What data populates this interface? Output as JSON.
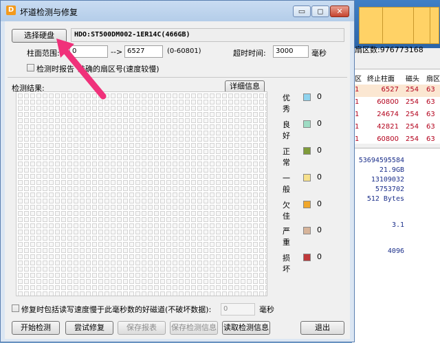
{
  "window": {
    "title": "坏道检测与修复",
    "min_glyph": "▭",
    "max_glyph": "◻",
    "close_glyph": "✕"
  },
  "disk": {
    "select_button": "选择硬盘",
    "info": "HDO:ST500DM002-1ER14C(466GB)"
  },
  "range": {
    "label": "柱面范围:",
    "start": "0",
    "arrow": "-->",
    "end": "6527",
    "hint": "(0-60801)"
  },
  "timeout": {
    "label": "超时时间:",
    "value": "3000",
    "unit": "毫秒"
  },
  "report_option": {
    "label_a": "检测时报告",
    "label_b": "准确的扇区号(速度较慢)"
  },
  "results": {
    "label": "检测结果:",
    "detail_button": "详细信息"
  },
  "legend": [
    {
      "name": "优秀",
      "color": "#8fd3ee",
      "count": "0"
    },
    {
      "name": "良好",
      "color": "#9edcc4",
      "count": "0"
    },
    {
      "name": "正常",
      "color": "#7f9b3a",
      "count": "0"
    },
    {
      "name": "一般",
      "color": "#f6e08c",
      "count": "0"
    },
    {
      "name": "欠佳",
      "color": "#f0a72b",
      "count": "0"
    },
    {
      "name": "严重",
      "color": "#d7b49a",
      "count": "0"
    },
    {
      "name": "损坏",
      "color": "#c0393b",
      "count": "0"
    }
  ],
  "repair_option": {
    "label": "修复时包括读写速度慢于此毫秒数的好磁道(不破坏数据):",
    "value": "0",
    "unit": "毫秒"
  },
  "buttons": {
    "start": "开始检测",
    "try_repair": "尝试修复",
    "save_report": "保存报表",
    "save_info": "保存检测信息",
    "load_info": "读取检测信息",
    "exit": "退出"
  },
  "background_app": {
    "summary": "扇区数:976773168",
    "table_headers": [
      "区",
      "终止柱面",
      "磁头",
      "扇区"
    ],
    "rows": [
      {
        "c0": "1",
        "end": "6527",
        "head": "254",
        "sec": "63"
      },
      {
        "c0": "1",
        "end": "60800",
        "head": "254",
        "sec": "63"
      },
      {
        "c0": "1",
        "end": "24674",
        "head": "254",
        "sec": "63"
      },
      {
        "c0": "1",
        "end": "42821",
        "head": "254",
        "sec": "63"
      },
      {
        "c0": "1",
        "end": "60800",
        "head": "254",
        "sec": "63"
      }
    ],
    "info_values": [
      "53694595584",
      "21.9GB",
      "13109032",
      "5753702",
      "512 Bytes",
      "3.1",
      "4096"
    ]
  },
  "colors": {
    "arrow": "#f0317a",
    "selected_row": "#fbe7d2",
    "row_text": "#b3001b"
  }
}
